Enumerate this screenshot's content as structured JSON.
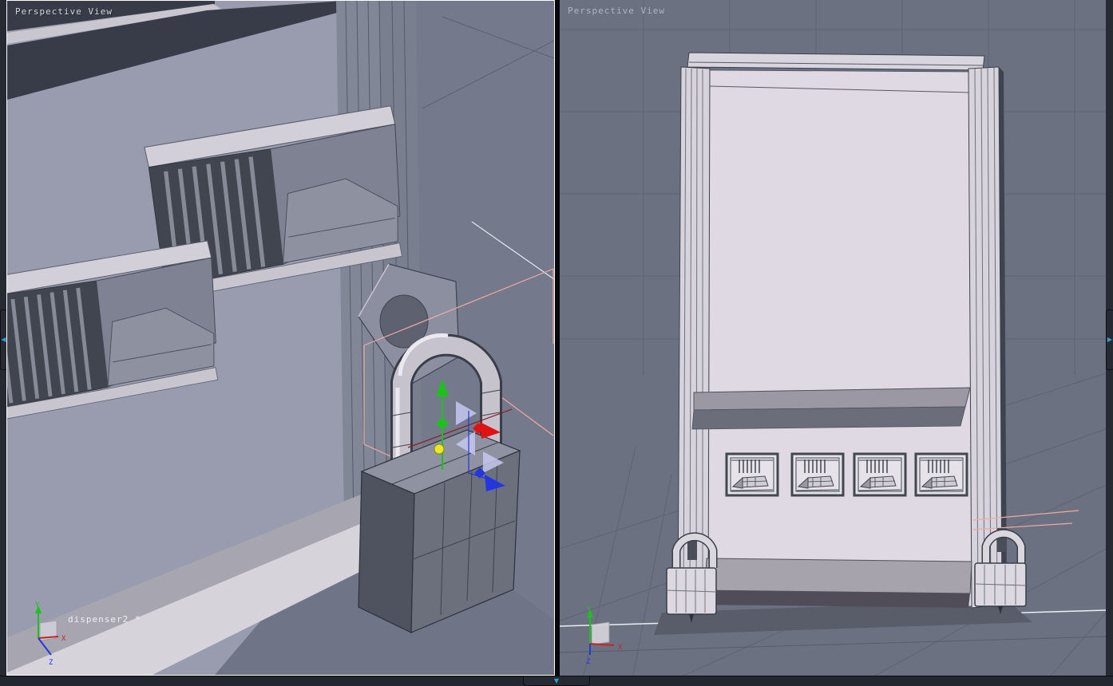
{
  "left_viewport": {
    "title": "Perspective View",
    "selected_object_label": "dispenser2 *",
    "axis": {
      "x": "X",
      "y": "Y",
      "z": "Z"
    }
  },
  "right_viewport": {
    "title": "Perspective View",
    "axis": {
      "x": "X",
      "y": "Y",
      "z": "Z"
    }
  },
  "chrome": {
    "left_splitter_icon": "◀",
    "right_splitter_icon": "▶",
    "bottom_splitter_icon": "▼"
  },
  "colors": {
    "selection_outline": "#f0aaa4",
    "gizmo_x": "#e01313",
    "gizmo_y": "#1cc11c",
    "gizmo_z": "#2336e0",
    "gizmo_highlight_yellow": "#ece821",
    "plane_handle_lavender": "#c6c8ef",
    "active_viewport_border": "#ffffff",
    "splitter_arrow": "#2f9fd0",
    "right_viewport_background": "#6b7181",
    "machine_body": "#ded9e3",
    "edge_wireframe": "#3a3e49"
  }
}
